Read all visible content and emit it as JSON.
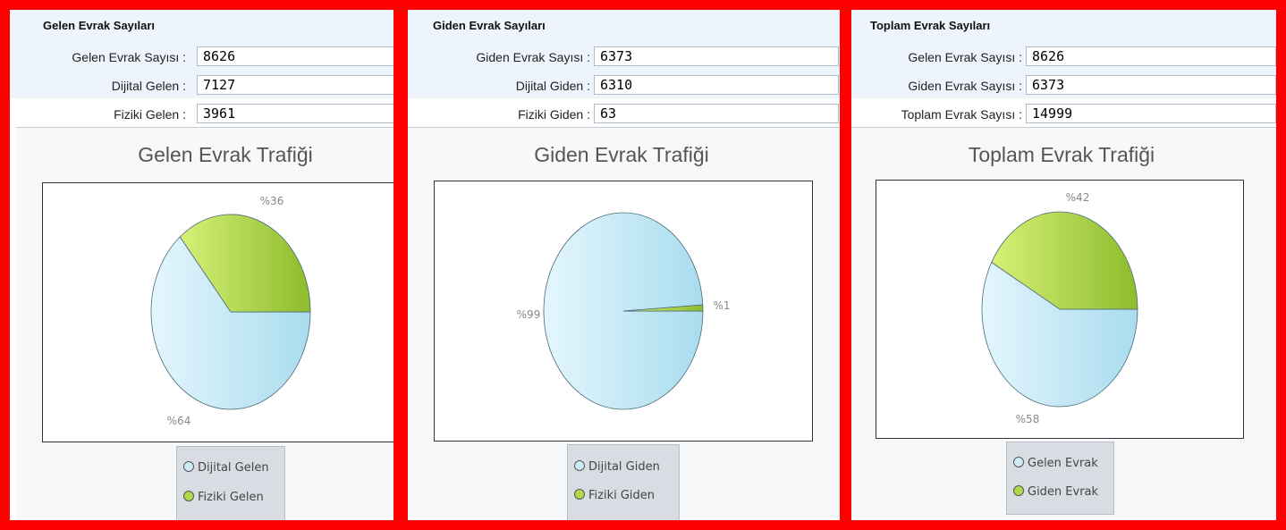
{
  "colors": {
    "frame": "#ff0000",
    "slice_blue": "#cfeaf7",
    "slice_green": "#b2d94a",
    "label": "#888888"
  },
  "panels": [
    {
      "header": {
        "title": "Gelen Evrak Sayıları",
        "rows": [
          {
            "label": "Gelen Evrak Sayısı :",
            "value": "8626"
          },
          {
            "label": "Dijital Gelen :",
            "value": "7127"
          },
          {
            "label": "Fiziki Gelen :",
            "value": "3961"
          }
        ]
      },
      "chart_data": {
        "type": "pie",
        "title": "Gelen Evrak Trafiği",
        "series": [
          {
            "name": "Dijital Gelen",
            "value": 64,
            "label": "%64",
            "color": "#cfeaf7"
          },
          {
            "name": "Fiziki Gelen",
            "value": 36,
            "label": "%36",
            "color": "#b2d94a"
          }
        ],
        "legend": "bottom"
      }
    },
    {
      "header": {
        "title": "Giden Evrak Sayıları",
        "rows": [
          {
            "label": "Giden Evrak Sayısı :",
            "value": "6373"
          },
          {
            "label": "Dijital Giden :",
            "value": "6310"
          },
          {
            "label": "Fiziki Giden :",
            "value": "63"
          }
        ]
      },
      "chart_data": {
        "type": "pie",
        "title": "Giden Evrak Trafiği",
        "series": [
          {
            "name": "Dijital Giden",
            "value": 99,
            "label": "%99",
            "color": "#cfeaf7"
          },
          {
            "name": "Fiziki Giden",
            "value": 1,
            "label": "%1",
            "color": "#b2d94a"
          }
        ],
        "legend": "bottom"
      }
    },
    {
      "header": {
        "title": "Toplam Evrak Sayıları",
        "rows": [
          {
            "label": "Gelen Evrak Sayısı :",
            "value": "8626"
          },
          {
            "label": "Giden Evrak Sayısı :",
            "value": "6373"
          },
          {
            "label": "Toplam Evrak Sayısı :",
            "value": "14999"
          }
        ]
      },
      "chart_data": {
        "type": "pie",
        "title": "Toplam Evrak Trafiği",
        "series": [
          {
            "name": "Gelen Evrak",
            "value": 58,
            "label": "%58",
            "color": "#cfeaf7"
          },
          {
            "name": "Giden Evrak",
            "value": 42,
            "label": "%42",
            "color": "#b2d94a"
          }
        ],
        "legend": "bottom"
      }
    }
  ]
}
